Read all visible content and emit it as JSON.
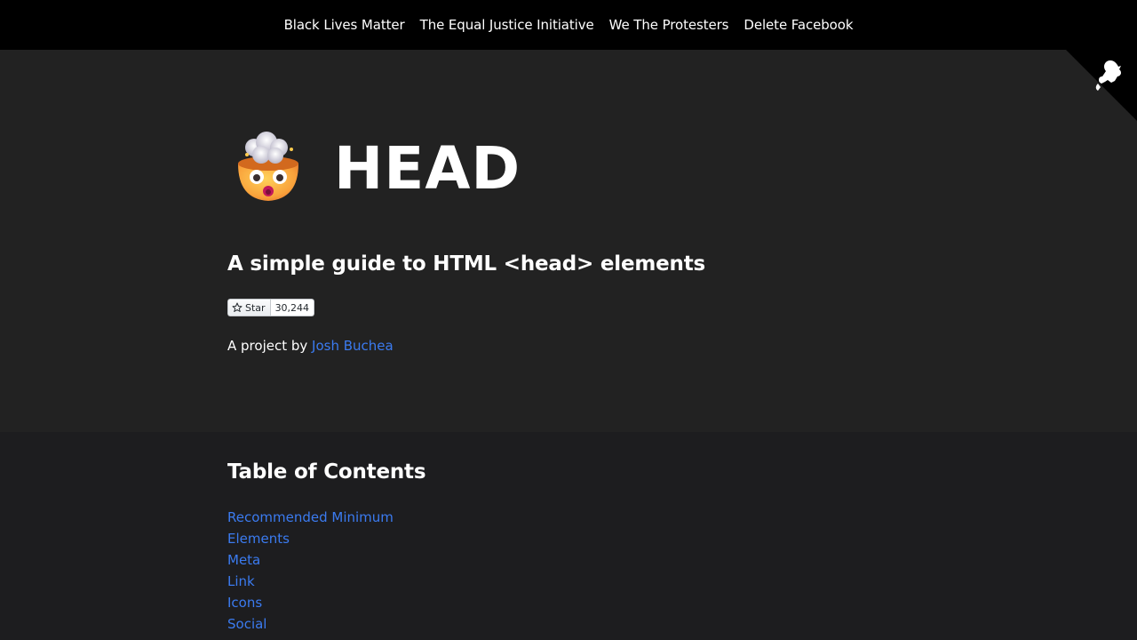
{
  "topnav": {
    "links": [
      "Black Lives Matter",
      "The Equal Justice Initiative",
      "We The Protesters",
      "Delete Facebook"
    ]
  },
  "hero": {
    "emoji_icon": "exploding-head-icon",
    "title": "HEAD",
    "tagline": "A simple guide to HTML <head> elements",
    "star_button": {
      "label": "Star",
      "count": "30,244"
    },
    "byline": {
      "prefix": "A project by ",
      "author": "Josh Buchea"
    },
    "corner_icon": "github-octocat-icon"
  },
  "toc": {
    "heading": "Table of Contents",
    "items": [
      "Recommended Minimum",
      "Elements",
      "Meta",
      "Link",
      "Icons",
      "Social"
    ]
  },
  "colors": {
    "nav_bg": "#000000",
    "hero_bg": "#222222",
    "page_bg": "#1d1d1f",
    "link": "#3b7bf0"
  }
}
